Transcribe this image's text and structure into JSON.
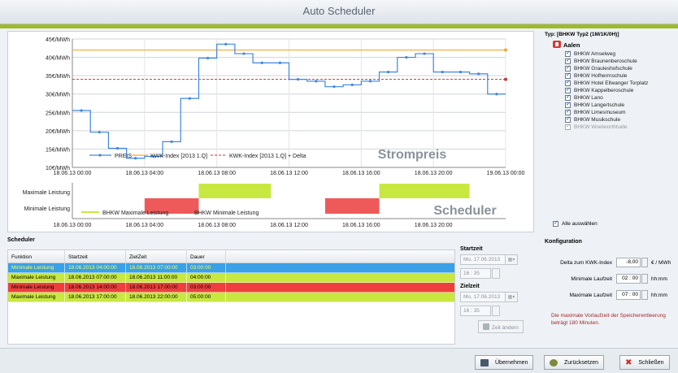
{
  "window": {
    "title": "Auto Scheduler"
  },
  "chart_data": [
    {
      "type": "line",
      "title": "Strompreis",
      "ylabel": "",
      "xlabel": "",
      "ylim": [
        10,
        45
      ],
      "y_ticks": [
        "10€/MWh",
        "15€/MWh",
        "20€/MWh",
        "25€/MWh",
        "30€/MWh",
        "35€/MWh",
        "40€/MWh",
        "45€/MWh"
      ],
      "x_ticks": [
        "18.06.13 00:00",
        "18.06.13 04:00",
        "18.06.13 08:00",
        "18.06.13 12:00",
        "18.06.13 16:00",
        "18.06.13 20:00",
        "19.06.13 00:00"
      ],
      "x_range_hours": [
        0,
        24
      ],
      "grid": true,
      "legend_position": "bottom-left",
      "series": [
        {
          "name": "PREIS",
          "color": "#3f86e0",
          "style": "step-markers",
          "x": [
            0,
            1,
            2,
            3,
            4,
            5,
            6,
            7,
            8,
            9,
            10,
            11,
            12,
            13,
            14,
            15,
            16,
            17,
            18,
            19,
            20,
            21,
            22,
            23,
            24
          ],
          "y": [
            25.5,
            19.6,
            15.2,
            12.5,
            13.0,
            17.0,
            28.8,
            39.8,
            43.6,
            41.0,
            38.5,
            38.5,
            34.0,
            33.5,
            32.0,
            32.5,
            33.5,
            36.0,
            40.0,
            41.0,
            36.0,
            36.0,
            35.5,
            30.0,
            30.0
          ]
        },
        {
          "name": "KWK-Index [2013 1.Q]",
          "color": "#f2a93b",
          "style": "line",
          "value": 42.0
        },
        {
          "name": "KWK-Index [2013 1.Q] + Delta",
          "color": "#c0392b",
          "style": "dashed",
          "value": 34.0
        }
      ]
    },
    {
      "type": "bar",
      "title": "Scheduler",
      "categories": [
        "Maximale Leistung",
        "Minimale Leistung"
      ],
      "x_ticks": [
        "18.06.13 00:00",
        "18.06.13 04:00",
        "18.06.13 08:00",
        "18.06.13 12:00",
        "18.06.13 16:00",
        "18.06.13 20:00"
      ],
      "x_range_hours": [
        0,
        24
      ],
      "legend_position": "bottom-left",
      "series": [
        {
          "name": "BHKW Maximale Leistung",
          "color": "#c8e840",
          "category": "Maximale Leistung",
          "intervals_hours": [
            [
              7,
              11
            ],
            [
              17,
              22
            ]
          ]
        },
        {
          "name": "BHKW Minimale Leistung",
          "color": "#ee5a5a",
          "category": "Minimale Leistung",
          "intervals_hours": [
            [
              4,
              7
            ],
            [
              14,
              17
            ]
          ]
        }
      ]
    }
  ],
  "right_panel": {
    "typ_label": "Typ: [BHKW Typ2 (1M/1K/0H)]",
    "group": "Aalen",
    "plants": [
      {
        "label": "BHKW Amselweg",
        "checked": true,
        "enabled": true
      },
      {
        "label": "BHKW Braunenberoschule",
        "checked": true,
        "enabled": true
      },
      {
        "label": "BHKW Grauleshofschule",
        "checked": true,
        "enabled": true
      },
      {
        "label": "BHKW Hofherrnschule",
        "checked": true,
        "enabled": true
      },
      {
        "label": "BHKW Hotel Ellwanger Torplatz",
        "checked": true,
        "enabled": true
      },
      {
        "label": "BHKW Kappelberoschule",
        "checked": true,
        "enabled": true
      },
      {
        "label": "BHKW Lano",
        "checked": true,
        "enabled": true
      },
      {
        "label": "BHKW Langertschule",
        "checked": true,
        "enabled": true
      },
      {
        "label": "BHKW Limesmuseum",
        "checked": true,
        "enabled": true
      },
      {
        "label": "BHKW Musikschule",
        "checked": true,
        "enabled": true
      },
      {
        "label": "BHKW Woelworthhalle",
        "checked": true,
        "enabled": false
      }
    ],
    "select_all": "Alle auswählen"
  },
  "scheduler": {
    "heading": "Scheduler",
    "columns": [
      "Funktion",
      "Startzeit",
      "ZielZeit",
      "Dauer"
    ],
    "rows": [
      {
        "funktion": "Minimale Leistung",
        "start": "18.06.2013 04:00:00",
        "ziel": "18.06.2013 07:00:00",
        "dauer": "03:00:00",
        "style": "min-sel"
      },
      {
        "funktion": "Maximale Leistung",
        "start": "18.06.2013 07:00:00",
        "ziel": "18.06.2013 11:00:00",
        "dauer": "04:00:00",
        "style": "max"
      },
      {
        "funktion": "Minimale Leistung",
        "start": "18.06.2013 14:00:00",
        "ziel": "18.06.2013 17:00:00",
        "dauer": "03:00:00",
        "style": "min"
      },
      {
        "funktion": "Maximale Leistung",
        "start": "18.06.2013 17:00:00",
        "ziel": "18.06.2013 22:00:00",
        "dauer": "05:00:00",
        "style": "max"
      }
    ]
  },
  "time_edit": {
    "start_label": "Startzeit",
    "start_date": "Mo, 17.06.2013",
    "start_time": "16 : 35",
    "ziel_label": "Zielzeit",
    "ziel_date": "Mo, 17.06.2013",
    "ziel_time": "16 : 35",
    "change_button": "Zeit ändern"
  },
  "konfiguration": {
    "heading": "Konfiguration",
    "delta_label": "Delta zum KWK-Index",
    "delta_value": "-8,00",
    "delta_unit": "€ / MWh",
    "min_label": "Minimale Laufzeit",
    "min_value": "02 : 00",
    "min_unit": "hh:mm",
    "max_label": "Maximale Laufzeit",
    "max_value": "07 : 00",
    "max_unit": "hh:mm",
    "note": "Die maximale Vorlaufzeit der Speicherentleerung beträgt 180 Minuten."
  },
  "footer": {
    "apply": "Übernehmen",
    "reset": "Zurücksetzen",
    "close": "Schließen"
  }
}
